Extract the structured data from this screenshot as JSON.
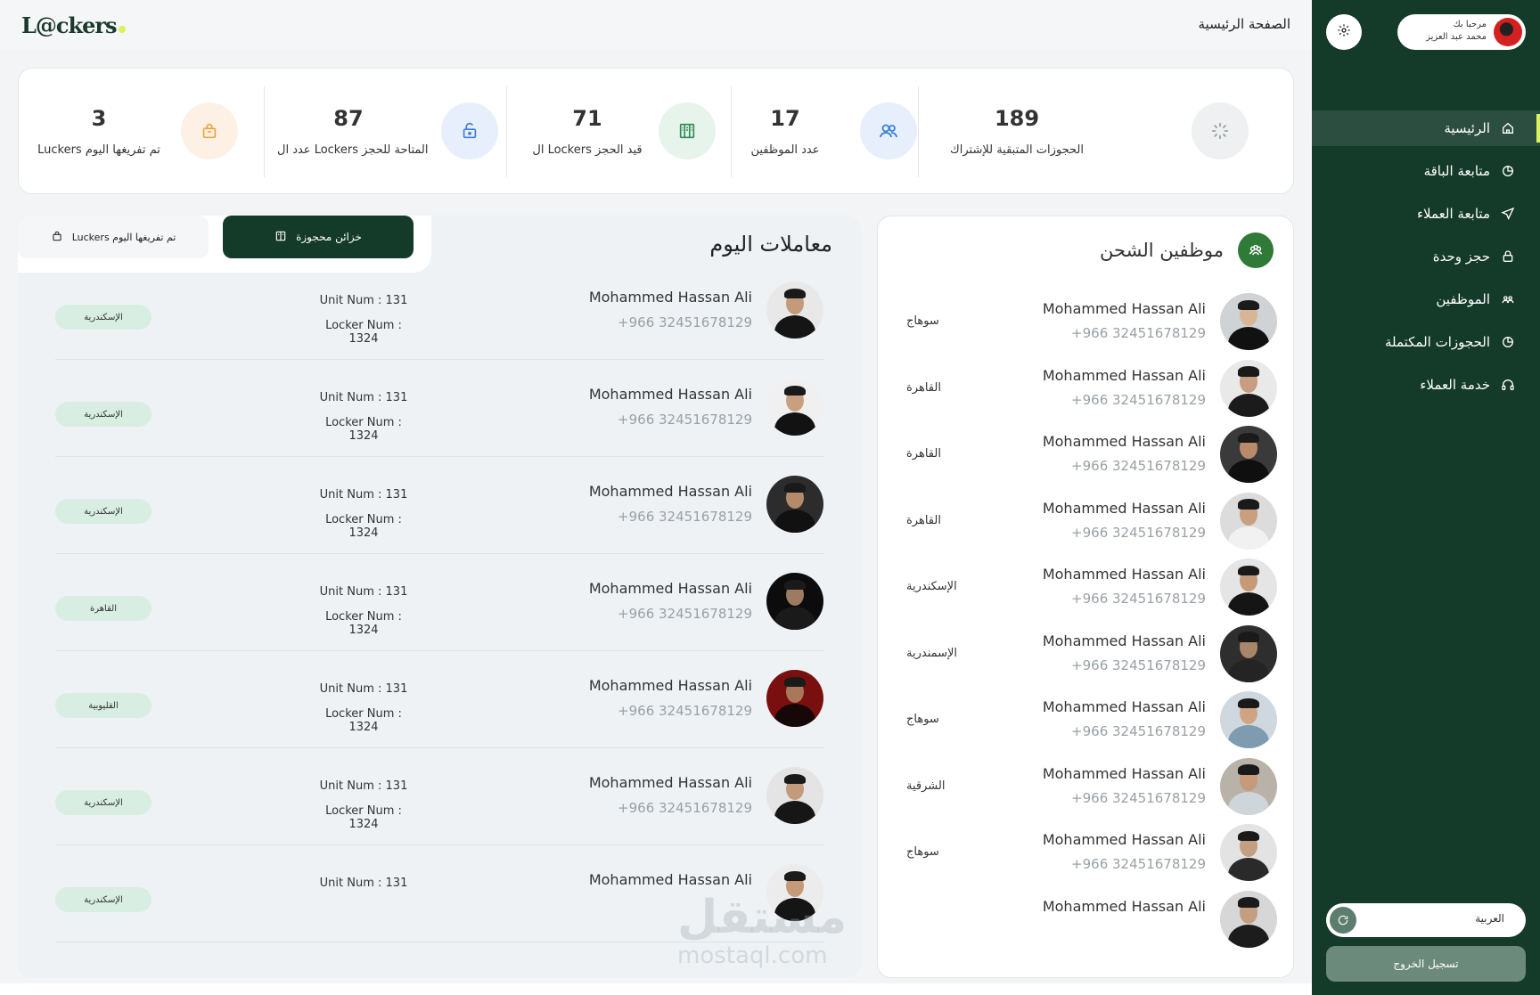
{
  "header": {
    "logo_text": "L@ckers",
    "page_title": "الصفحة الرئيسية"
  },
  "profile": {
    "greeting": "مرحبا بك",
    "name": "محمد عبد العزيز"
  },
  "sidebar": {
    "items": [
      {
        "label": "الرئيسية",
        "icon": "home-icon",
        "active": true
      },
      {
        "label": "متابعة الباقة",
        "icon": "chart-icon",
        "active": false
      },
      {
        "label": "متابعة العملاء",
        "icon": "send-icon",
        "active": false
      },
      {
        "label": "حجز وحدة",
        "icon": "lock-icon",
        "active": false
      },
      {
        "label": "الموظفين",
        "icon": "users-icon",
        "active": false
      },
      {
        "label": "الحجوزات المكتملة",
        "icon": "chart-icon",
        "active": false
      },
      {
        "label": "خدمة العملاء",
        "icon": "headset-icon",
        "active": false
      }
    ],
    "language": "العربية",
    "logout": "تسجيل الخروج"
  },
  "stats": [
    {
      "value": "189",
      "label": "الحجوزات المتبقية للإشتراك",
      "icon": "spinner-icon",
      "color": "#eef0f1",
      "iconColor": "#9aa3a8"
    },
    {
      "value": "17",
      "label": "عدد الموظفين",
      "icon": "users-icon",
      "color": "#e6effb",
      "iconColor": "#3b7ddd"
    },
    {
      "value": "71",
      "label": "ال Lockers قيد الحجز",
      "icon": "locker-icon",
      "color": "#e6f4ec",
      "iconColor": "#2f8a57"
    },
    {
      "value": "87",
      "label": "عدد ال Lockers  المتاحة للحجز",
      "icon": "unlock-icon",
      "color": "#e6effb",
      "iconColor": "#3b7ddd"
    },
    {
      "value": "3",
      "label": "Luckers تم تفريغها اليوم",
      "icon": "bag-icon",
      "color": "#fdf1e6",
      "iconColor": "#f0a23a"
    }
  ],
  "employees": {
    "title": "موظفين الشحن",
    "rows": [
      {
        "name": "Mohammed Hassan Ali",
        "phone": "+966 32451678129",
        "city": "سوهاج"
      },
      {
        "name": "Mohammed Hassan Ali",
        "phone": "+966 32451678129",
        "city": "القاهرة"
      },
      {
        "name": "Mohammed Hassan Ali",
        "phone": "+966 32451678129",
        "city": "القاهرة"
      },
      {
        "name": "Mohammed Hassan Ali",
        "phone": "+966 32451678129",
        "city": "القاهرة"
      },
      {
        "name": "Mohammed Hassan Ali",
        "phone": "+966 32451678129",
        "city": "الإسكندرية"
      },
      {
        "name": "Mohammed Hassan Ali",
        "phone": "+966 32451678129",
        "city": "الإسمندرية"
      },
      {
        "name": "Mohammed Hassan Ali",
        "phone": "+966 32451678129",
        "city": "سوهاج"
      },
      {
        "name": "Mohammed Hassan Ali",
        "phone": "+966 32451678129",
        "city": "الشرقية"
      },
      {
        "name": "Mohammed Hassan Ali",
        "phone": "+966 32451678129",
        "city": "سوهاج"
      },
      {
        "name": "Mohammed Hassan Ali",
        "phone": "",
        "city": ""
      }
    ]
  },
  "transactions": {
    "title": "معاملات اليوم",
    "tab_reserved": "خزائن محجوزة",
    "tab_emptied": "Luckers تم تفريغها اليوم",
    "rows": [
      {
        "name": "Mohammed Hassan Ali",
        "phone": "+966 32451678129",
        "unit": "Unit Num : 131",
        "locker": "Locker Num : 1324",
        "city": "الإسكندرية"
      },
      {
        "name": "Mohammed Hassan Ali",
        "phone": "+966 32451678129",
        "unit": "Unit Num : 131",
        "locker": "Locker Num : 1324",
        "city": "الإسكندرية"
      },
      {
        "name": "Mohammed Hassan Ali",
        "phone": "+966 32451678129",
        "unit": "Unit Num : 131",
        "locker": "Locker Num : 1324",
        "city": "الإسكندرية"
      },
      {
        "name": "Mohammed Hassan Ali",
        "phone": "+966 32451678129",
        "unit": "Unit Num : 131",
        "locker": "Locker Num : 1324",
        "city": "القاهرة"
      },
      {
        "name": "Mohammed Hassan Ali",
        "phone": "+966 32451678129",
        "unit": "Unit Num : 131",
        "locker": "Locker Num : 1324",
        "city": "القليوبية"
      },
      {
        "name": "Mohammed Hassan Ali",
        "phone": "+966 32451678129",
        "unit": "Unit Num : 131",
        "locker": "Locker Num : 1324",
        "city": "الإسكندرية"
      },
      {
        "name": "Mohammed Hassan Ali",
        "phone": "",
        "unit": "Unit Num : 131",
        "locker": "",
        "city": "الإسكندرية"
      }
    ]
  },
  "watermark": {
    "line1": "مستقل",
    "line2": "mostaql.com"
  },
  "theme": {
    "sidebar": "#143a2a",
    "accent": "#d9f25c",
    "pill": "#d8eee3"
  }
}
